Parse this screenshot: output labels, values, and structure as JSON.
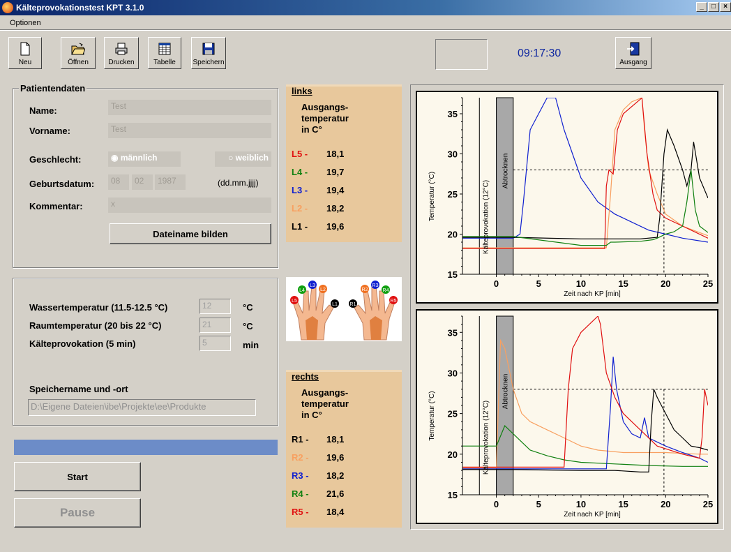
{
  "window": {
    "title": "Kälteprovokationstest KPT 3.1.0",
    "min": "_",
    "max": "□",
    "close": "×"
  },
  "menu": {
    "items": [
      "Optionen"
    ]
  },
  "toolbar": {
    "new_label": "Neu",
    "open_label": "Öffnen",
    "print_label": "Drucken",
    "table_label": "Tabelle",
    "save_label": "Speichern",
    "exit_label": "Ausgang"
  },
  "clock": "09:17:30",
  "patient": {
    "title": "Patientendaten",
    "name_label": "Name:",
    "name_value": "Test",
    "vorname_label": "Vorname:",
    "vorname_value": "Test",
    "geschlecht_label": "Geschlecht:",
    "male_label": "männlich",
    "female_label": "weiblich",
    "geburtsdatum_label": "Geburtsdatum:",
    "day": "08",
    "month": "02",
    "year": "1987",
    "date_format": "(dd.mm.jjjj)",
    "kommentar_label": "Kommentar:",
    "kommentar_value": "x",
    "filename_button": "Dateiname bilden"
  },
  "settings": {
    "wasser_label": "Wassertemperatur (11.5-12.5 °C)",
    "wasser_value": "12",
    "wasser_unit": "°C",
    "raum_label": "Raumtemperatur (20 bis 22 °C)",
    "raum_value": "21",
    "raum_unit": "°C",
    "kp_label": "Kälteprovokation (5 min)",
    "kp_value": "5",
    "kp_unit": "min",
    "storage_label": "Speichername und -ort",
    "storage_value": "D:\\Eigene Dateien\\ibe\\Projekte\\ee\\Produkte"
  },
  "progress": 1.0,
  "buttons": {
    "start": "Start",
    "pause": "Pause"
  },
  "left_temps": {
    "title": "links",
    "subtitle_lines": [
      "Ausgangs-",
      "temperatur",
      "in C°"
    ],
    "rows": [
      {
        "key": "L5 -",
        "value": "18,1",
        "color": "#e01010"
      },
      {
        "key": "L4 -",
        "value": "19,7",
        "color": "#108010"
      },
      {
        "key": "L3 -",
        "value": "19,4",
        "color": "#1020d0"
      },
      {
        "key": "L2 -",
        "value": "18,2",
        "color": "#f8a060"
      },
      {
        "key": "L1 -",
        "value": "19,6",
        "color": "#000000"
      }
    ]
  },
  "right_temps": {
    "title": "rechts",
    "subtitle_lines": [
      "Ausgangs-",
      "temperatur",
      "in C°"
    ],
    "rows": [
      {
        "key": "R1 -",
        "value": "18,1",
        "color": "#000000"
      },
      {
        "key": "R2 -",
        "value": "19,6",
        "color": "#f8a060"
      },
      {
        "key": "R3 -",
        "value": "18,2",
        "color": "#1020d0"
      },
      {
        "key": "R4 -",
        "value": "21,6",
        "color": "#108010"
      },
      {
        "key": "R5 -",
        "value": "18,4",
        "color": "#e01010"
      }
    ]
  },
  "hands": {
    "left_fingers": [
      "L5",
      "L4",
      "L3",
      "L2",
      "L1"
    ],
    "right_fingers": [
      "R1",
      "R2",
      "R3",
      "R4",
      "R5"
    ]
  },
  "chart_data": [
    {
      "type": "line",
      "xlabel": "Zeit nach KP [min]",
      "ylabel": "Temperatur (°C)",
      "xlim": [
        -4,
        25
      ],
      "ylim": [
        15,
        37
      ],
      "xticks": [
        0,
        5,
        10,
        15,
        20,
        25
      ],
      "yticks": [
        15,
        20,
        25,
        30,
        35
      ],
      "reference_y": 28,
      "reference_x": 19.8,
      "annotations": [
        "Kälteprovokation (12°C)",
        "Abtrocknen"
      ],
      "band": [
        0,
        2
      ],
      "series": [
        {
          "color": "#1020d0",
          "x": [
            -4,
            2,
            2.8,
            3.2,
            4,
            5,
            6,
            7,
            8,
            9,
            10,
            12,
            14,
            16,
            18,
            20,
            22,
            25
          ],
          "y": [
            19.5,
            19.5,
            20,
            24,
            33,
            35,
            37,
            37,
            33,
            30,
            27,
            24,
            22.5,
            21.5,
            20.5,
            20,
            19.5,
            19
          ]
        },
        {
          "color": "#f8a060",
          "x": [
            -4,
            2,
            13,
            13.5,
            14,
            15,
            16,
            17.2,
            17.5,
            18,
            19,
            20,
            22,
            25
          ],
          "y": [
            18.3,
            18.3,
            18.3,
            25,
            33,
            35.5,
            36.5,
            37,
            33,
            28,
            25,
            22.5,
            21,
            19.8
          ]
        },
        {
          "color": "#e01010",
          "x": [
            -4,
            2,
            12.8,
            13,
            13.3,
            13.8,
            14.3,
            15,
            17,
            17.2,
            17.8,
            18.5,
            19,
            20,
            22,
            25
          ],
          "y": [
            18.2,
            18.2,
            18.2,
            26,
            28,
            27.5,
            33,
            35,
            36.8,
            37,
            30,
            25,
            23,
            22,
            21,
            19.5
          ]
        },
        {
          "color": "#000000",
          "x": [
            -4,
            2,
            10,
            17,
            19,
            19.3,
            19.8,
            20.2,
            21,
            22,
            22.5,
            23,
            23.3,
            24,
            25
          ],
          "y": [
            19.6,
            19.6,
            19.4,
            19.4,
            19.6,
            22,
            30,
            33,
            31,
            28,
            26,
            28,
            31.5,
            27,
            24.5
          ]
        },
        {
          "color": "#108010",
          "x": [
            -4,
            2,
            10,
            13,
            13.5,
            14,
            17,
            18.5,
            19,
            20,
            21,
            22,
            22.5,
            23,
            23.5,
            24,
            25
          ],
          "y": [
            19.7,
            19.7,
            18.6,
            18.6,
            19,
            19,
            19.1,
            19.3,
            19.5,
            20,
            20.3,
            21,
            24,
            28,
            23,
            21,
            20.2
          ]
        }
      ]
    },
    {
      "type": "line",
      "xlabel": "Zeit nach KP [min]",
      "ylabel": "Temperatur (°C)",
      "xlim": [
        -4,
        25
      ],
      "ylim": [
        15,
        37
      ],
      "xticks": [
        0,
        5,
        10,
        15,
        20,
        25
      ],
      "yticks": [
        15,
        20,
        25,
        30,
        35
      ],
      "reference_y": 28,
      "reference_x": 19.8,
      "annotations": [
        "Kälteprovokation (12°C)",
        "Abtrocknen"
      ],
      "band": [
        0,
        2
      ],
      "series": [
        {
          "color": "#f8a060",
          "x": [
            -4,
            0,
            0.5,
            1,
            2,
            3,
            4,
            6,
            8,
            10,
            12,
            15,
            20,
            24,
            24.5,
            25
          ],
          "y": [
            18.3,
            18.3,
            34,
            33,
            28,
            25,
            24,
            23,
            22,
            21,
            20.5,
            20.2,
            20.2,
            20,
            20,
            20
          ]
        },
        {
          "color": "#108010",
          "x": [
            -4,
            0,
            1,
            2,
            3,
            4,
            6,
            8,
            10,
            14,
            18,
            22,
            25
          ],
          "y": [
            21,
            21,
            23.5,
            22.5,
            21.5,
            20.5,
            19.8,
            19.3,
            19,
            18.8,
            18.6,
            18.5,
            18.5
          ]
        },
        {
          "color": "#1020d0",
          "x": [
            -4,
            2,
            10,
            13,
            13.5,
            13.8,
            14.2,
            15,
            16,
            17,
            17.5,
            18,
            19,
            20,
            22,
            24,
            25
          ],
          "y": [
            18.2,
            18.2,
            18.2,
            18.2,
            26,
            32,
            28,
            24,
            22.5,
            22,
            24.5,
            22,
            21.5,
            21,
            20.2,
            19.5,
            19
          ]
        },
        {
          "color": "#e01010",
          "x": [
            -4,
            2,
            8,
            8.5,
            9,
            10,
            11,
            12,
            12.3,
            13,
            14,
            15,
            17,
            19,
            22,
            24,
            24.3,
            24.6,
            25
          ],
          "y": [
            18.4,
            18.4,
            18.4,
            28,
            33,
            35,
            36,
            37,
            36,
            30,
            27,
            25,
            23,
            21,
            20,
            19.5,
            22,
            28,
            26
          ]
        },
        {
          "color": "#000000",
          "x": [
            -4,
            2,
            10,
            14,
            17,
            18,
            18.3,
            18.6,
            19,
            20,
            21,
            22,
            23,
            24,
            25
          ],
          "y": [
            18.1,
            18.1,
            18,
            18,
            17.8,
            17.8,
            24,
            28,
            27,
            25,
            23,
            22,
            21,
            20.8,
            20.5
          ]
        }
      ]
    }
  ]
}
